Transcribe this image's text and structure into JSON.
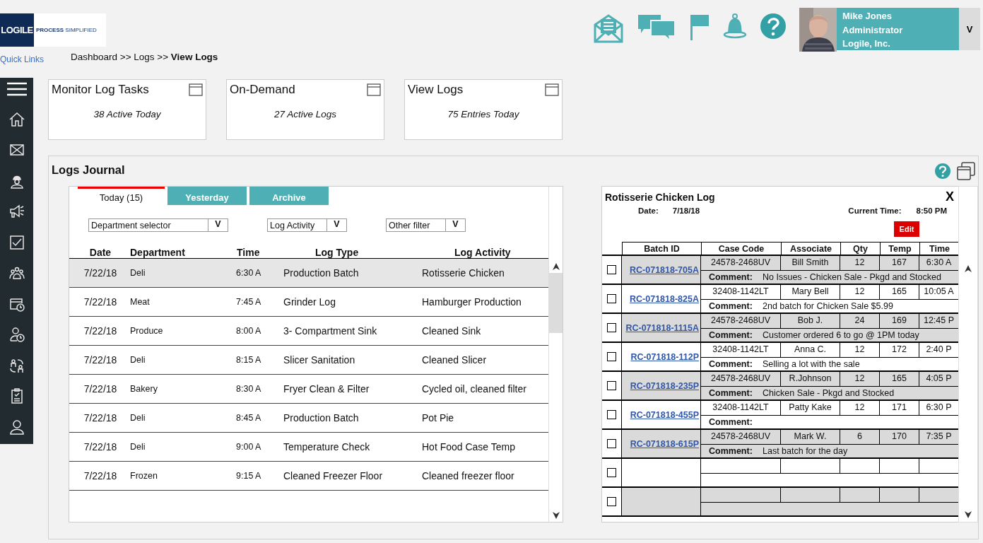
{
  "logo": {
    "name": "LOGILE",
    "tagline_bold": "PROCESS",
    "tagline": "SIMPLIFIED"
  },
  "quick_links": "Quick Links",
  "breadcrumb": {
    "path": "Dashboard >> Logs >> ",
    "current": "View Logs"
  },
  "user": {
    "name": "Mike Jones",
    "role": "Administrator",
    "company": "Logile, Inc.",
    "menu": "V"
  },
  "cards": [
    {
      "title": "Monitor Log Tasks",
      "subtitle": "38 Active Today"
    },
    {
      "title": "On-Demand",
      "subtitle": "27 Active Logs"
    },
    {
      "title": "View Logs",
      "subtitle": "75 Entries Today"
    }
  ],
  "journal": {
    "title": "Logs Journal",
    "tabs": [
      {
        "label": "Today (15)",
        "selected": true
      },
      {
        "label": "Yesterday",
        "selected": false
      },
      {
        "label": "Archive",
        "selected": false
      }
    ],
    "filters": [
      {
        "label": "Department selector",
        "button": "V"
      },
      {
        "label": "Log Activity",
        "button": "V"
      },
      {
        "label": "Other filter",
        "button": "V"
      }
    ],
    "columns": [
      "Date",
      "Department",
      "Time",
      "Log Type",
      "Log Activity"
    ],
    "rows": [
      {
        "date": "7/22/18",
        "department": "Deli",
        "time": "6:30 A",
        "log_type": "Production Batch",
        "activity": "Rotisserie Chicken",
        "selected": true
      },
      {
        "date": "7/22/18",
        "department": "Meat",
        "time": "7:45 A",
        "log_type": "Grinder Log",
        "activity": "Hamburger Production",
        "selected": false
      },
      {
        "date": "7/22/18",
        "department": "Produce",
        "time": "8:00 A",
        "log_type": "3- Compartment Sink",
        "activity": "Cleaned Sink",
        "selected": false
      },
      {
        "date": "7/22/18",
        "department": "Deli",
        "time": "8:15 A",
        "log_type": "Slicer Sanitation",
        "activity": "Cleaned Slicer",
        "selected": false
      },
      {
        "date": "7/22/18",
        "department": "Bakery",
        "time": "8:30 A",
        "log_type": "Fryer Clean & Filter",
        "activity": "Cycled oil, cleaned filter",
        "selected": false
      },
      {
        "date": "7/22/18",
        "department": "Deli",
        "time": "8:45 A",
        "log_type": "Production Batch",
        "activity": "Pot Pie",
        "selected": false
      },
      {
        "date": "7/22/18",
        "department": "Deli",
        "time": "9:00 A",
        "log_type": "Temperature Check",
        "activity": "Hot Food Case Temp",
        "selected": false
      },
      {
        "date": "7/22/18",
        "department": "Frozen",
        "time": "9:15 A",
        "log_type": "Cleaned Freezer Floor",
        "activity": "Cleaned freezer floor",
        "selected": false
      }
    ]
  },
  "detail": {
    "title": "Rotisserie Chicken Log",
    "close": "X",
    "date_label": "Date:",
    "date": "7/18/18",
    "time_label": "Current Time:",
    "time": "8:50 PM",
    "edit": "Edit",
    "columns": [
      "Batch ID",
      "Case Code",
      "Associate",
      "Qty",
      "Temp",
      "Time"
    ],
    "rows": [
      {
        "checked": false,
        "batch": "RC-071818-705A",
        "case_code": "24578-2468UV",
        "associate": "Bill Smith",
        "qty": "12",
        "temp": "167",
        "time": "6:30 A",
        "comment_label": "Comment:",
        "comment": "No Issues - Chicken Sale - Pkgd and Stocked"
      },
      {
        "checked": false,
        "batch": "RC-071818-825A",
        "case_code": "32408-1142LT",
        "associate": "Mary Bell",
        "qty": "12",
        "temp": "165",
        "time": "10:05 A",
        "comment_label": "Comment:",
        "comment": "2nd batch for Chicken Sale $5.99"
      },
      {
        "checked": false,
        "batch": "RC-071818-1115A",
        "case_code": "24578-2468UV",
        "associate": "Bob J.",
        "qty": "24",
        "temp": "169",
        "time": "12:45 P",
        "comment_label": "Comment:",
        "comment": "Customer ordered 6 to go @ 1PM today"
      },
      {
        "checked": false,
        "batch": "RC-071818-112P",
        "case_code": "32408-1142LT",
        "associate": "Anna C.",
        "qty": "12",
        "temp": "172",
        "time": "2:40 P",
        "comment_label": "Comment:",
        "comment": "Selling a lot with the sale"
      },
      {
        "checked": false,
        "batch": "RC-071818-235P",
        "case_code": "24578-2468UV",
        "associate": "R.Johnson",
        "qty": "12",
        "temp": "165",
        "time": "4:05 P",
        "comment_label": "Comment:",
        "comment": "Chicken Sale - Pkgd and Stocked"
      },
      {
        "checked": false,
        "batch": "RC-071818-455P",
        "case_code": "32408-1142LT",
        "associate": "Patty Kake",
        "qty": "12",
        "temp": "171",
        "time": "6:30 P",
        "comment_label": "Comment:"
      },
      {
        "checked": false,
        "batch": "RC-071818-615P",
        "case_code": "24578-2468UV",
        "associate": "Mark W.",
        "qty": "6",
        "temp": "170",
        "time": "7:35 P",
        "comment_label": "Comment:",
        "comment": "Last batch for the day"
      },
      {
        "checked": false
      },
      {
        "checked": false
      }
    ]
  }
}
